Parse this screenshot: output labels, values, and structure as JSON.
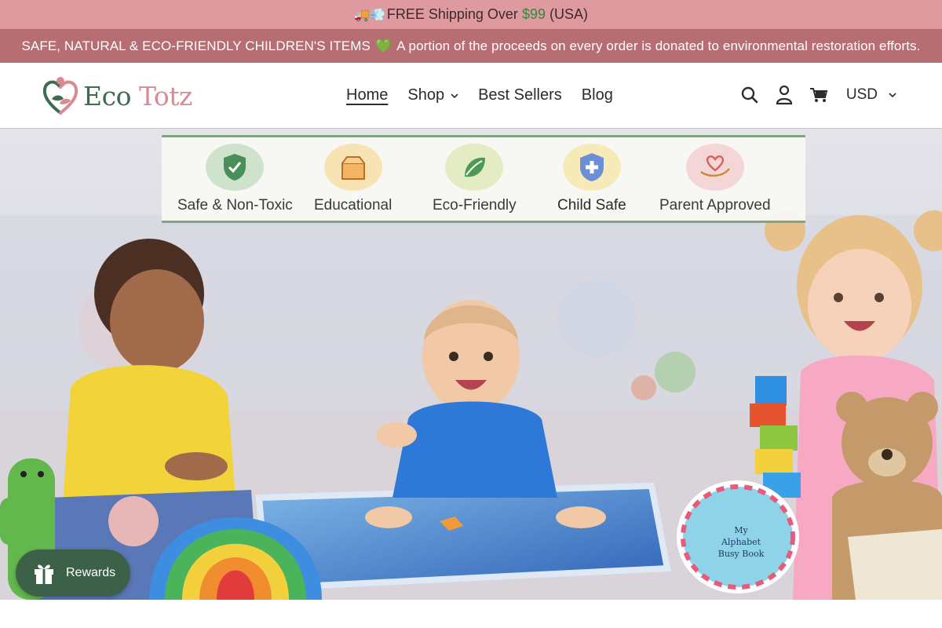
{
  "announcement": {
    "shipping_prefix": "🚚💨",
    "shipping_text": "FREE Shipping Over",
    "shipping_price": "$99",
    "shipping_suffix": "(USA)",
    "mission_text": "SAFE, NATURAL & ECO-FRIENDLY CHILDREN'S ITEMS",
    "mission_emoji": "💚",
    "mission_detail": "A portion of the proceeds on every order is donated to environmental restoration efforts."
  },
  "header": {
    "logo_word1": "Eco",
    "logo_word2": "Totz",
    "nav": [
      {
        "label": "Home",
        "active": true
      },
      {
        "label": "Shop",
        "dropdown": true
      },
      {
        "label": "Best Sellers"
      },
      {
        "label": "Blog"
      }
    ],
    "icons": [
      "search-icon",
      "account-icon",
      "cart-icon"
    ],
    "currency": "USD"
  },
  "hero": {
    "badges": [
      {
        "label": "Safe & Non-Toxic",
        "icon": "shield-check-icon",
        "color": "#cfe3cc"
      },
      {
        "label": "Educational",
        "icon": "box-icon",
        "color": "#f7e3b3"
      },
      {
        "label": "Eco-Friendly",
        "icon": "leaf-icon",
        "color": "#e4ecc4"
      },
      {
        "label": "Child Safe",
        "icon": "shield-plus-icon",
        "color": "#f6ebb8"
      },
      {
        "label": "Parent Approved",
        "icon": "heart-hand-icon",
        "color": "#f4d6d6"
      }
    ],
    "book_title_line1": "My",
    "book_title_line2": "Alphabet",
    "book_title_line3": "Busy Book"
  },
  "rewards": {
    "label": "Rewards"
  },
  "colors": {
    "top_bar": "#df9aa0",
    "second_bar": "#b66e73",
    "brand_green": "#3c6148",
    "brand_pink": "#d98a92"
  }
}
